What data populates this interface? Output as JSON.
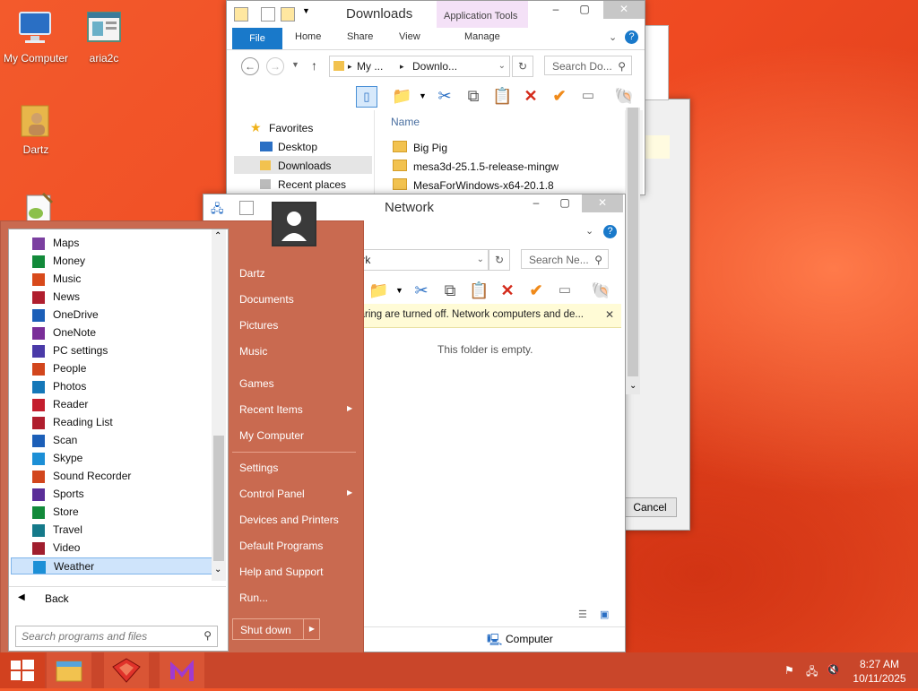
{
  "desktop": {
    "icons": [
      {
        "label": "My Computer",
        "icon": "computer-icon"
      },
      {
        "label": "aria2c",
        "icon": "window-app-icon"
      },
      {
        "label": "Dartz",
        "icon": "user-folder-icon"
      },
      {
        "label": "",
        "icon": "notepad-plus-icon"
      }
    ]
  },
  "downloads_window": {
    "title": "Downloads",
    "context_tab": "Application Tools",
    "tabs": [
      "File",
      "Home",
      "Share",
      "View",
      "Manage"
    ],
    "address_crumbs": [
      "My ...",
      "Downlo..."
    ],
    "search_placeholder": "Search Do...",
    "nav": {
      "favorites_label": "Favorites",
      "items": [
        "Desktop",
        "Downloads",
        "Recent places"
      ]
    },
    "column_name": "Name",
    "files": [
      "Big Pig",
      "mesa3d-25.1.5-release-mingw",
      "MesaForWindows-x64-20.1.8"
    ]
  },
  "network_window": {
    "title": "Network",
    "address": "...work",
    "search_placeholder": "Search Ne...",
    "infobar": "...overy and file sharing are turned off. Network computers and de...",
    "empty_message": "This folder is empty.",
    "status_item": "Computer"
  },
  "back_dialog": {
    "cancel_label": "Cancel"
  },
  "start_menu": {
    "apps": [
      {
        "label": "Maps",
        "color": "#7b3fa0"
      },
      {
        "label": "Money",
        "color": "#128a3a"
      },
      {
        "label": "Music",
        "color": "#d84a1b"
      },
      {
        "label": "News",
        "color": "#b01e2e"
      },
      {
        "label": "OneDrive",
        "color": "#1c5fb8"
      },
      {
        "label": "OneNote",
        "color": "#7a2e98"
      },
      {
        "label": "PC settings",
        "color": "#4a3aa8"
      },
      {
        "label": "People",
        "color": "#d2461d"
      },
      {
        "label": "Photos",
        "color": "#1477b8"
      },
      {
        "label": "Reader",
        "color": "#c41e2e"
      },
      {
        "label": "Reading List",
        "color": "#b01e2e"
      },
      {
        "label": "Scan",
        "color": "#1c5fb8"
      },
      {
        "label": "Skype",
        "color": "#1c8fd6"
      },
      {
        "label": "Sound Recorder",
        "color": "#d2461d"
      },
      {
        "label": "Sports",
        "color": "#5a2e98"
      },
      {
        "label": "Store",
        "color": "#128a3a"
      },
      {
        "label": "Travel",
        "color": "#157a8a"
      },
      {
        "label": "Video",
        "color": "#a01e2e"
      },
      {
        "label": "Weather",
        "color": "#1c8fd6"
      }
    ],
    "back_label": "Back",
    "search_placeholder": "Search programs and files",
    "user_name": "Dartz",
    "right_items": [
      "Documents",
      "Pictures",
      "Music",
      "Games",
      "Recent Items",
      "My Computer",
      "Settings",
      "Control Panel",
      "Devices and Printers",
      "Default Programs",
      "Help and Support",
      "Run..."
    ],
    "shutdown_label": "Shut down"
  },
  "taskbar": {
    "time": "8:27 AM",
    "date": "10/11/2025"
  }
}
